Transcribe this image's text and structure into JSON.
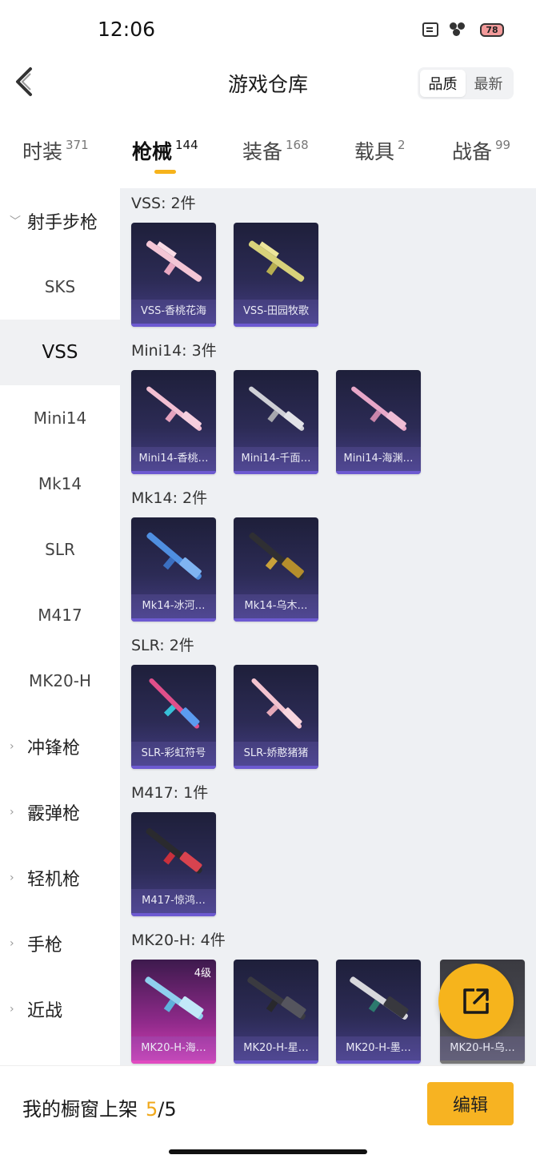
{
  "status": {
    "time": "12:06",
    "battery": "78"
  },
  "header": {
    "title": "游戏仓库",
    "sort_quality": "品质",
    "sort_latest": "最新"
  },
  "tabs": [
    {
      "label": "时装",
      "count": "371"
    },
    {
      "label": "枪械",
      "count": "144"
    },
    {
      "label": "装备",
      "count": "168"
    },
    {
      "label": "载具",
      "count": "2"
    },
    {
      "label": "战备",
      "count": "99"
    }
  ],
  "sidebar": {
    "group_open": "射手步枪",
    "items": [
      "SKS",
      "VSS",
      "Mini14",
      "Mk14",
      "SLR",
      "M417",
      "MK20-H"
    ],
    "groups": [
      "冲锋枪",
      "霰弹枪",
      "轻机枪",
      "手枪",
      "近战"
    ]
  },
  "content": {
    "groups": [
      {
        "title": "VSS: 2件",
        "items": [
          "VSS-香桃花海",
          "VSS-田园牧歌"
        ]
      },
      {
        "title": "Mini14: 3件",
        "items": [
          "Mini14-香桃…",
          "Mini14-千面…",
          "Mini14-海渊…"
        ]
      },
      {
        "title": "Mk14: 2件",
        "items": [
          "Mk14-冰河…",
          "Mk14-乌木…"
        ]
      },
      {
        "title": "SLR: 2件",
        "items": [
          "SLR-彩虹符号",
          "SLR-娇憨猪猪"
        ]
      },
      {
        "title": "M417: 1件",
        "items": [
          "M417-惊鸿…"
        ]
      },
      {
        "title": "MK20-H: 4件",
        "items": [
          "MK20-H-海…",
          "MK20-H-星…",
          "MK20-H-墨…",
          "MK20-H-乌…"
        ],
        "level": "4级"
      }
    ]
  },
  "bottom": {
    "label": "我的橱窗上架",
    "used": "5",
    "sep": "/",
    "total": "5",
    "edit": "编辑"
  },
  "colors": {
    "accent": "#f6b31b",
    "card_bg": "#2c2b55",
    "card_highlight": "#d53fb4"
  },
  "icons": [
    "back-chevron-icon",
    "share-export-icon",
    "chevron-down-icon",
    "chevron-right-icon"
  ]
}
